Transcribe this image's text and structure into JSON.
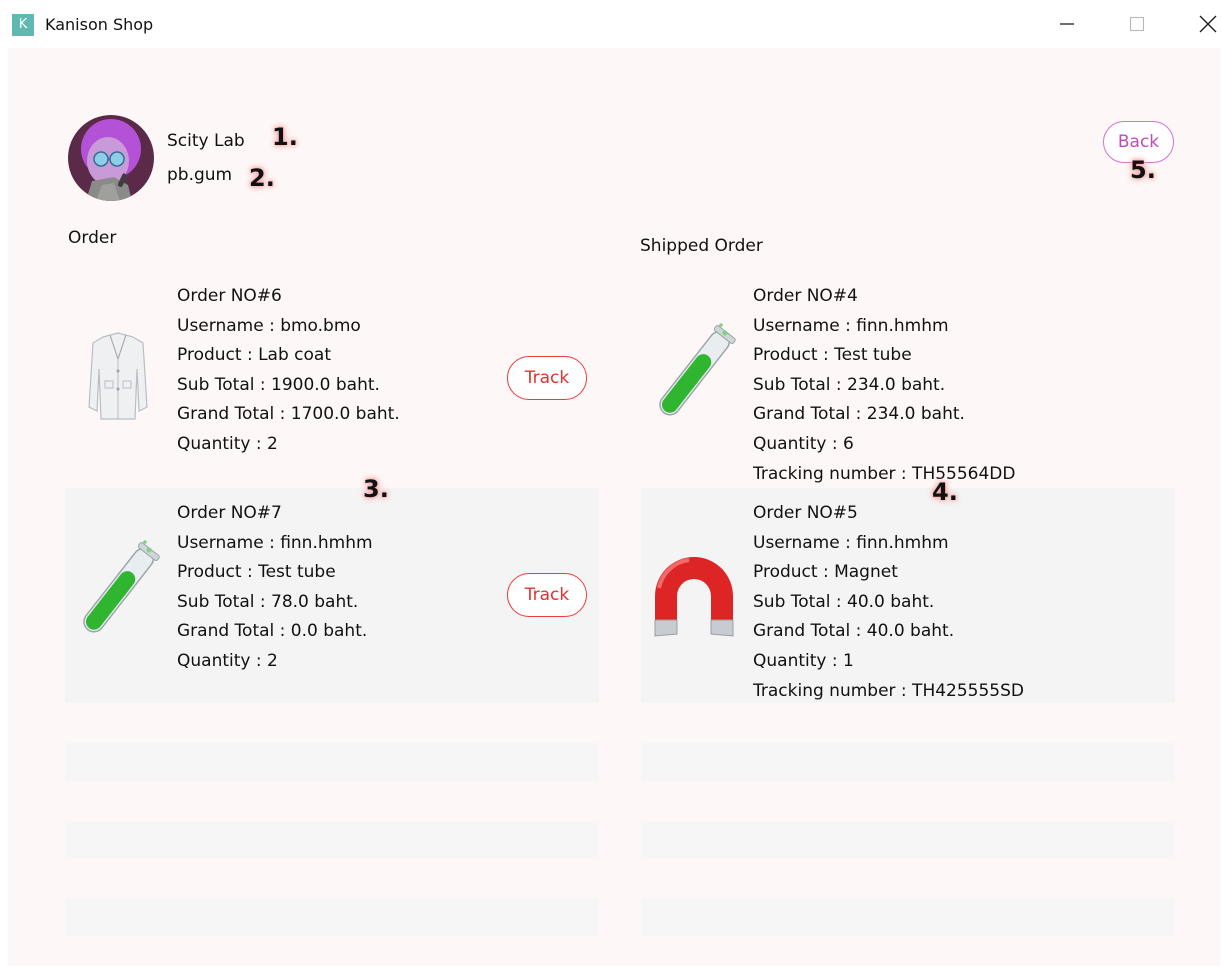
{
  "window": {
    "title": "Kanison Shop",
    "icon_letter": "K"
  },
  "profile": {
    "shop_name": "Scity Lab",
    "username": "pb.gum"
  },
  "back_label": "Back",
  "markers": {
    "m1": "1.",
    "m2": "2.",
    "m3": "3.",
    "m4": "4.",
    "m5": "5."
  },
  "orders": {
    "title": "Order",
    "items": [
      {
        "order_no": "Order NO#6",
        "username": "Username : bmo.bmo",
        "product": "Product : Lab coat",
        "sub_total": "Sub Total : 1900.0 baht.",
        "grand_total": "Grand Total : 1700.0 baht.",
        "quantity": "Quantity : 2",
        "action": "Track",
        "icon": "lab-coat-icon"
      },
      {
        "order_no": "Order NO#7",
        "username": "Username : finn.hmhm",
        "product": "Product : Test tube",
        "sub_total": "Sub Total : 78.0 baht.",
        "grand_total": "Grand Total : 0.0 baht.",
        "quantity": "Quantity : 2",
        "action": "Track",
        "icon": "test-tube-icon"
      }
    ]
  },
  "shipped": {
    "title": "Shipped Order",
    "items": [
      {
        "order_no": "Order NO#4",
        "username": "Username : finn.hmhm",
        "product": "Product : Test tube",
        "sub_total": "Sub Total : 234.0 baht.",
        "grand_total": "Grand Total : 234.0 baht.",
        "quantity": "Quantity : 6",
        "tracking": "Tracking number : TH55564DD",
        "icon": "test-tube-icon"
      },
      {
        "order_no": "Order NO#5",
        "username": "Username : finn.hmhm",
        "product": "Product : Magnet",
        "sub_total": "Sub Total : 40.0 baht.",
        "grand_total": "Grand Total : 40.0 baht.",
        "quantity": "Quantity : 1",
        "tracking": "Tracking number : TH425555SD",
        "icon": "magnet-icon"
      }
    ]
  },
  "colors": {
    "content_bg": "#fdf8f7",
    "track_red": "#e33030",
    "back_pink": "#c04bb8",
    "app_icon": "#5fb9b0"
  }
}
